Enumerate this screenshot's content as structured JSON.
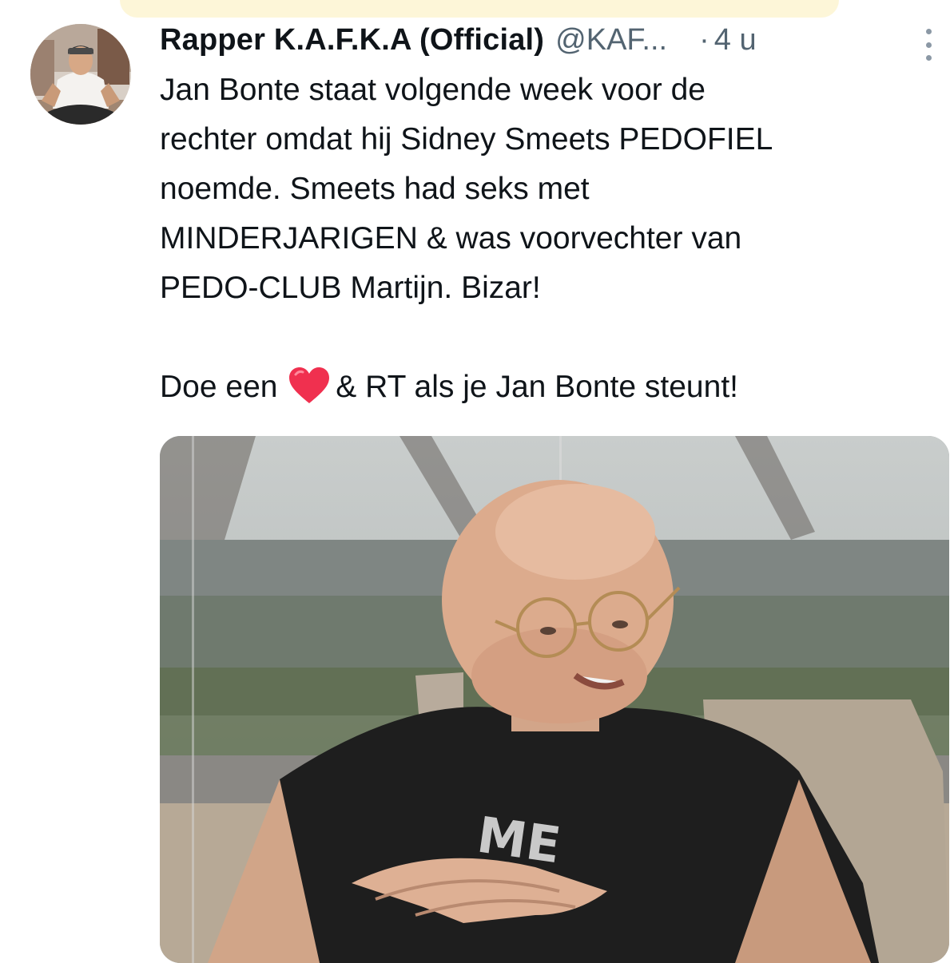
{
  "tweet": {
    "display_name": "Rapper K.A.F.K.A (Official)",
    "handle": "@KAF...",
    "separator": "·",
    "time": "4 u",
    "text_lines": [
      "Jan Bonte staat volgende week voor de",
      "rechter omdat hij Sidney Smeets PEDOFIEL",
      "noemde. Smeets had seks met",
      "MINDERJARIGEN & was voorvechter van",
      "PEDO-CLUB Martijn. Bizar!"
    ],
    "cta_before": "Doe een",
    "cta_after": "& RT als je Jan Bonte steunt!",
    "icons": {
      "more": "more-vertical-icon",
      "heart": "red-heart-emoji"
    }
  },
  "media": {
    "shirt_text": "ME"
  },
  "colors": {
    "text": "#0f1419",
    "secondary": "#536471",
    "heart": "#f0304f",
    "top_strip": "#fdf6d8"
  }
}
